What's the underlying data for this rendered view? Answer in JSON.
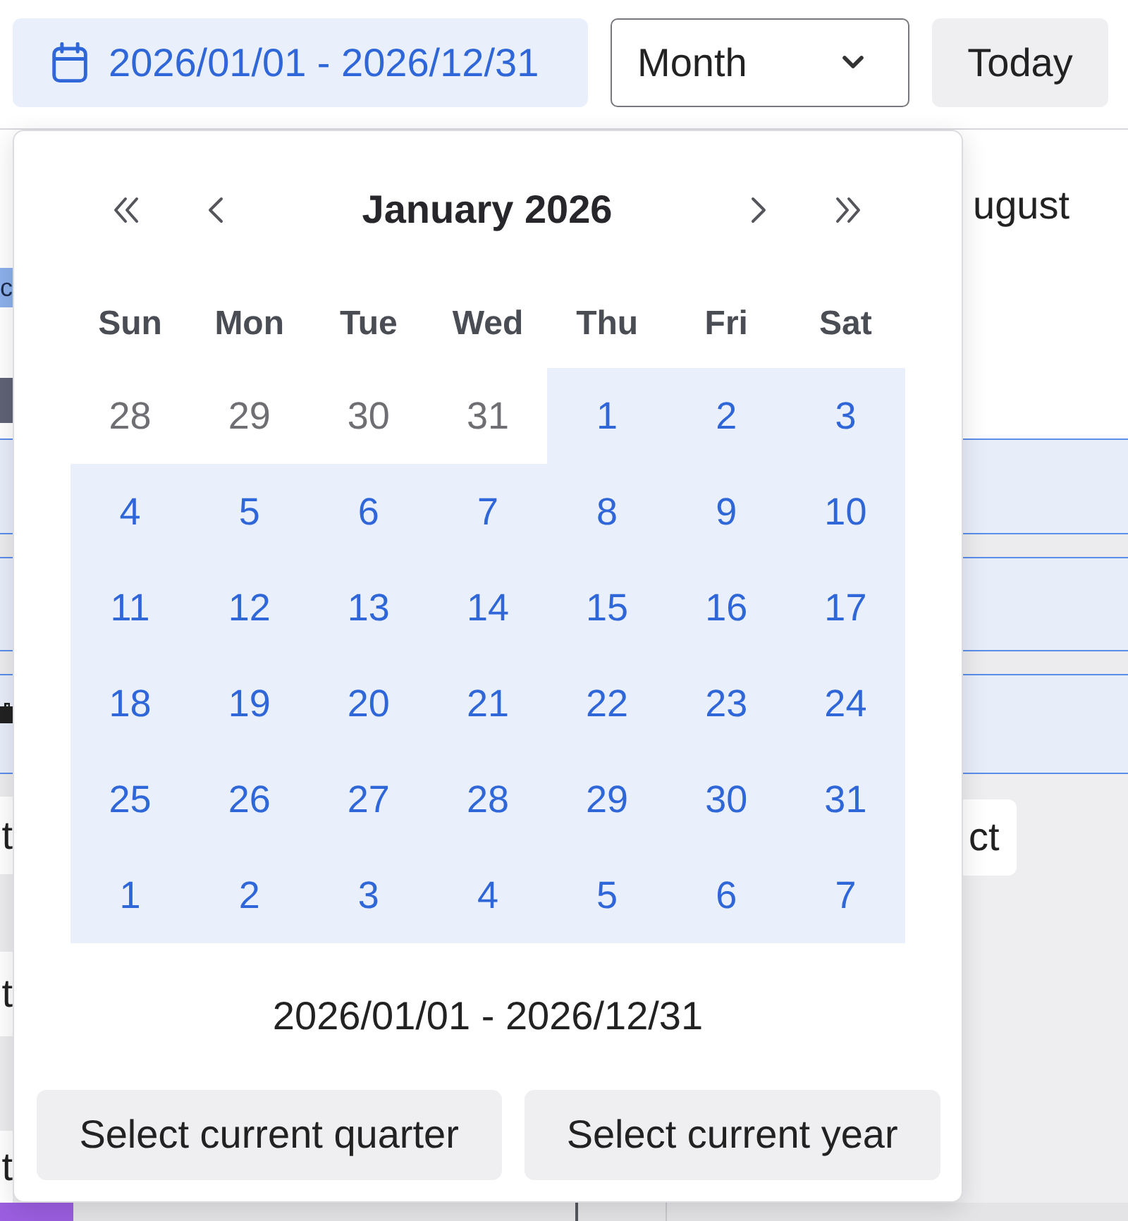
{
  "toolbar": {
    "date_range": "2026/01/01 - 2026/12/31",
    "view_select": {
      "value": "Month"
    },
    "today_button": "Today"
  },
  "background": {
    "month_label": "ugust",
    "event_label": "c",
    "row_labels": [
      "t",
      "t",
      "t"
    ],
    "side_button": "ct"
  },
  "date_picker": {
    "title": "January 2026",
    "weekdays": [
      "Sun",
      "Mon",
      "Tue",
      "Wed",
      "Thu",
      "Fri",
      "Sat"
    ],
    "weeks": [
      [
        {
          "day": "28",
          "in_range": false
        },
        {
          "day": "29",
          "in_range": false
        },
        {
          "day": "30",
          "in_range": false
        },
        {
          "day": "31",
          "in_range": false
        },
        {
          "day": "1",
          "in_range": true
        },
        {
          "day": "2",
          "in_range": true
        },
        {
          "day": "3",
          "in_range": true
        }
      ],
      [
        {
          "day": "4",
          "in_range": true
        },
        {
          "day": "5",
          "in_range": true
        },
        {
          "day": "6",
          "in_range": true
        },
        {
          "day": "7",
          "in_range": true
        },
        {
          "day": "8",
          "in_range": true
        },
        {
          "day": "9",
          "in_range": true
        },
        {
          "day": "10",
          "in_range": true
        }
      ],
      [
        {
          "day": "11",
          "in_range": true
        },
        {
          "day": "12",
          "in_range": true
        },
        {
          "day": "13",
          "in_range": true
        },
        {
          "day": "14",
          "in_range": true
        },
        {
          "day": "15",
          "in_range": true
        },
        {
          "day": "16",
          "in_range": true
        },
        {
          "day": "17",
          "in_range": true
        }
      ],
      [
        {
          "day": "18",
          "in_range": true
        },
        {
          "day": "19",
          "in_range": true
        },
        {
          "day": "20",
          "in_range": true
        },
        {
          "day": "21",
          "in_range": true
        },
        {
          "day": "22",
          "in_range": true
        },
        {
          "day": "23",
          "in_range": true
        },
        {
          "day": "24",
          "in_range": true
        }
      ],
      [
        {
          "day": "25",
          "in_range": true
        },
        {
          "day": "26",
          "in_range": true
        },
        {
          "day": "27",
          "in_range": true
        },
        {
          "day": "28",
          "in_range": true
        },
        {
          "day": "29",
          "in_range": true
        },
        {
          "day": "30",
          "in_range": true
        },
        {
          "day": "31",
          "in_range": true
        }
      ],
      [
        {
          "day": "1",
          "in_range": true
        },
        {
          "day": "2",
          "in_range": true
        },
        {
          "day": "3",
          "in_range": true
        },
        {
          "day": "4",
          "in_range": true
        },
        {
          "day": "5",
          "in_range": true
        },
        {
          "day": "6",
          "in_range": true
        },
        {
          "day": "7",
          "in_range": true
        }
      ]
    ],
    "range_text": "2026/01/01 - 2026/12/31",
    "buttons": [
      "Select current quarter",
      "Select current year"
    ]
  }
}
